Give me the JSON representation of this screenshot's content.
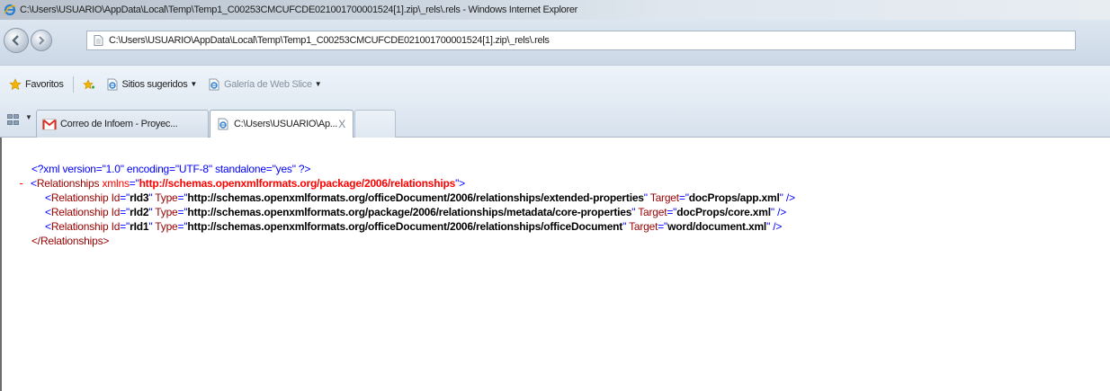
{
  "window": {
    "title": "C:\\Users\\USUARIO\\AppData\\Local\\Temp\\Temp1_C00253CMCUFCDE021001700001524[1].zip\\_rels\\.rels - Windows Internet Explorer"
  },
  "address_bar": {
    "value": "C:\\Users\\USUARIO\\AppData\\Local\\Temp\\Temp1_C00253CMCUFCDE021001700001524[1].zip\\_rels\\.rels"
  },
  "favorites_bar": {
    "favorites_label": "Favoritos",
    "suggested_sites_label": "Sitios sugeridos",
    "web_slice_gallery_label": "Galería de Web Slice"
  },
  "tabs": [
    {
      "label": "Correo de Infoem - Proyec...",
      "icon": "gmail-icon",
      "active": false
    },
    {
      "label": "C:\\Users\\USUARIO\\Ap...",
      "icon": "ie-page-icon",
      "active": true
    }
  ],
  "tab_close_glyph": "X",
  "xml": {
    "declaration": "<?xml version=\"1.0\" encoding=\"UTF-8\" standalone=\"yes\" ?>",
    "collapse_marker": "-",
    "root_tag": "Relationships",
    "root_ns_attr": "xmlns",
    "root_ns_value": "http://schemas.openxmlformats.org/package/2006/relationships",
    "relationships": [
      {
        "tag": "Relationship",
        "id": "rId3",
        "type": "http://schemas.openxmlformats.org/officeDocument/2006/relationships/extended-properties",
        "target": "docProps/app.xml"
      },
      {
        "tag": "Relationship",
        "id": "rId2",
        "type": "http://schemas.openxmlformats.org/package/2006/relationships/metadata/core-properties",
        "target": "docProps/core.xml"
      },
      {
        "tag": "Relationship",
        "id": "rId1",
        "type": "http://schemas.openxmlformats.org/officeDocument/2006/relationships/officeDocument",
        "target": "word/document.xml"
      }
    ],
    "attr_names": {
      "id": "Id",
      "type": "Type",
      "target": "Target"
    },
    "root_close": "</Relationships>"
  },
  "colors": {
    "xml_tag": "#990000",
    "xml_punct": "#0000ff",
    "xml_namespace": "#ff0000"
  }
}
